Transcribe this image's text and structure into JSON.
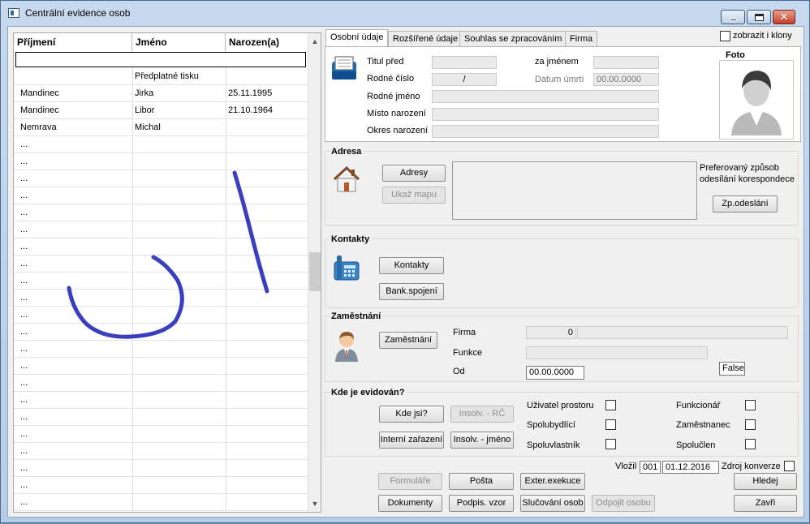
{
  "window": {
    "title": "Centrální evidence osob"
  },
  "grid": {
    "columns": [
      "Příjmení",
      "Jméno",
      "Narozen(a)"
    ],
    "filter_value": "",
    "rows": [
      {
        "c1": "",
        "c2": "Předplatné tisku",
        "c3": ""
      },
      {
        "c1": "Mandinec",
        "c2": "Jirka",
        "c3": "25.11.1995"
      },
      {
        "c1": "Mandinec",
        "c2": "Libor",
        "c3": "21.10.1964"
      },
      {
        "c1": "Nemrava",
        "c2": "Michal",
        "c3": ""
      }
    ],
    "placeholder_row": "...",
    "placeholder_count": 22
  },
  "tabs": [
    "Osobní údaje",
    "Rozšířené údaje",
    "Souhlas se zpracováním",
    "Firma"
  ],
  "clones_label": "zobrazit i klony",
  "personal": {
    "titul_pred": "Titul před",
    "za_jmenem": "za jménem",
    "rodne_cislo": "Rodné číslo",
    "rodne_cislo_value": "/",
    "datum_umrti": "Datum úmrtí",
    "datum_umrti_value": "00.00.0000",
    "rodne_jmeno": "Rodné jméno",
    "misto_narozeni": "Místo narození",
    "okres_narozeni": "Okres narození",
    "foto": "Foto"
  },
  "adresa": {
    "title": "Adresa",
    "adresy_btn": "Adresy",
    "mapa_btn": "Ukaž mapu",
    "pref_line1": "Preferovaný způsob",
    "pref_line2": "odesílání korespondece",
    "zp_btn": "Zp.odeslání"
  },
  "kontakty": {
    "title": "Kontakty",
    "kontakty_btn": "Kontakty",
    "bank_btn": "Bank.spojení"
  },
  "zamestnani": {
    "title": "Zaměstnání",
    "btn": "Zaměstnání",
    "firma_label": "Firma",
    "firma_value": "0",
    "funkce_label": "Funkce",
    "od_label": "Od",
    "od_value": "00.00.0000",
    "false_label": "False"
  },
  "evidovan": {
    "title": "Kde je evidován?",
    "kde_btn": "Kde jsi?",
    "insolv_rc_btn": "Insolv. - RČ",
    "interni_btn": "Interní zařazení",
    "insolv_jmeno_btn": "Insolv. - jméno",
    "checks": [
      "Uživatel prostoru",
      "Spolubydlící",
      "Spoluvlastník",
      "Funkcionář",
      "Zaměstnanec",
      "Spolučlen"
    ]
  },
  "footer": {
    "vlozil_label": "Vložil",
    "vlozil_value": "001",
    "date_value": "01.12.2016",
    "zdroj_label": "Zdroj konverze",
    "formulare": "Formuláře",
    "posta": "Pošta",
    "exter": "Exter.exekuce",
    "hledej": "Hledej",
    "dokumenty": "Dokumenty",
    "podpis": "Podpis. vzor",
    "slucovani": "Slučování osob",
    "odpojit": "Odpojit osobu",
    "zavri": "Zavři"
  },
  "ink_color": "#3a3fc0"
}
